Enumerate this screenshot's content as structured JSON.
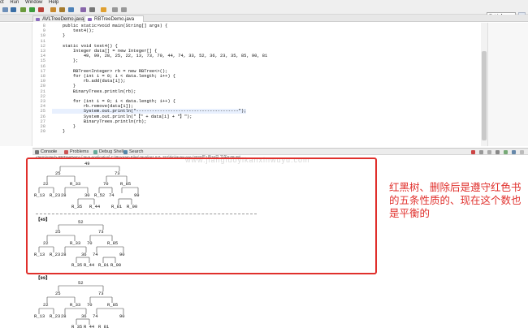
{
  "menubar": {
    "items": [
      "ct",
      "Run",
      "Window",
      "Help"
    ]
  },
  "toolbar": {
    "quick_access": "Quick Access"
  },
  "tabs": [
    {
      "label": "AVLTreeDemo.java"
    },
    {
      "label": "RBTreeDemo.java"
    }
  ],
  "editor": {
    "lines": [
      {
        "no": "8",
        "code": "    public static void main(String[] args) {"
      },
      {
        "no": "9",
        "code": "        test4();"
      },
      {
        "no": "10",
        "code": "    }"
      },
      {
        "no": "11",
        "code": ""
      },
      {
        "no": "12",
        "code": "    static void test4() {"
      },
      {
        "no": "13",
        "code": "        Integer data[] = new Integer[] {"
      },
      {
        "no": "14",
        "code": "            49, 99, 28, 25, 22, 13, 73, 70, 44, 74, 33, 52, 36, 23, 35, 85, 90, 81"
      },
      {
        "no": "15",
        "code": "        };"
      },
      {
        "no": "16",
        "code": ""
      },
      {
        "no": "17",
        "code": "        RBTree<Integer> rb = new RBTree<>();"
      },
      {
        "no": "18",
        "code": "        for (int i = 0; i < data.length; i++) {"
      },
      {
        "no": "19",
        "code": "            rb.add(data[i]);"
      },
      {
        "no": "20",
        "code": "        }"
      },
      {
        "no": "21",
        "code": "        BinaryTrees.println(rb);"
      },
      {
        "no": "22",
        "code": ""
      },
      {
        "no": "23",
        "code": "        for (int i = 0; i < data.length; i++) {"
      },
      {
        "no": "24",
        "code": "            rb.remove(data[i]);"
      },
      {
        "no": "25",
        "code": "            System.out.println(\"---------------------------------------\");"
      },
      {
        "no": "26",
        "code": "            System.out.println(\"【\" + data[i] + \"】\");"
      },
      {
        "no": "27",
        "code": "            BinaryTrees.println(rb);"
      },
      {
        "no": "28",
        "code": "        }"
      },
      {
        "no": "29",
        "code": "    }"
      }
    ]
  },
  "console": {
    "tabs": [
      "Console",
      "Problems",
      "Debug Shell",
      "Search"
    ],
    "terminated": "<terminated> RBTreeDemo [Java Application] C:\\Program Files\\Java\\jre1.8.0_151\\bin\\javaw.exe (2020年1月16日 下午5:09:48)",
    "watermark": "www.jiangluoyikanxinwuyu.com",
    "tree1": {
      "nodes": [
        "49",
        "25",
        "73",
        "22",
        "R_33",
        "70",
        "R_85",
        "R_13",
        "R_23",
        "28",
        "30",
        "R_52",
        "74",
        "99",
        "R_35",
        "R_44",
        "R_81",
        "R_90"
      ]
    },
    "label2": "【49】",
    "tree2": {
      "nodes": [
        "52",
        "25",
        "73",
        "22",
        "R_33",
        "70",
        "R_85",
        "R_13",
        "R_23",
        "28",
        "36",
        "74",
        "90",
        "R_35",
        "R_44",
        "R_81",
        "R_90"
      ]
    },
    "label3": "【99】",
    "tree3": {
      "nodes": [
        "52",
        "25",
        "73",
        "22",
        "R_33",
        "70",
        "R_85",
        "R_13",
        "R_23",
        "28",
        "36",
        "74",
        "90",
        "R_35",
        "R_44",
        "R_81"
      ]
    }
  },
  "annotation": "红黑树、删除后是遵守红色书的五条性质的、现在这个数也是平衡的",
  "colors": {
    "highlight_box": "#e0302c",
    "annotation_text": "#e0302c"
  }
}
